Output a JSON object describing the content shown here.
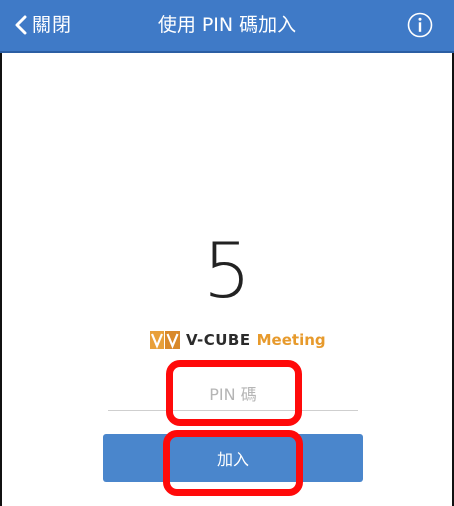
{
  "navbar": {
    "back_label": "關閉",
    "title": "使用 PIN 碼加入",
    "back_icon": "chevron-left-icon",
    "info_icon": "info-circle-icon"
  },
  "countdown": "5",
  "logo": {
    "brand": "V-CUBE",
    "product": "Meeting"
  },
  "pin_input": {
    "placeholder": "PIN 碼",
    "value": ""
  },
  "join_button": {
    "label": "加入"
  },
  "colors": {
    "navbar": "#3f7ac7",
    "button": "#4a86cc",
    "highlight": "#ff0a0a",
    "logo_accent": "#e79a2c"
  }
}
